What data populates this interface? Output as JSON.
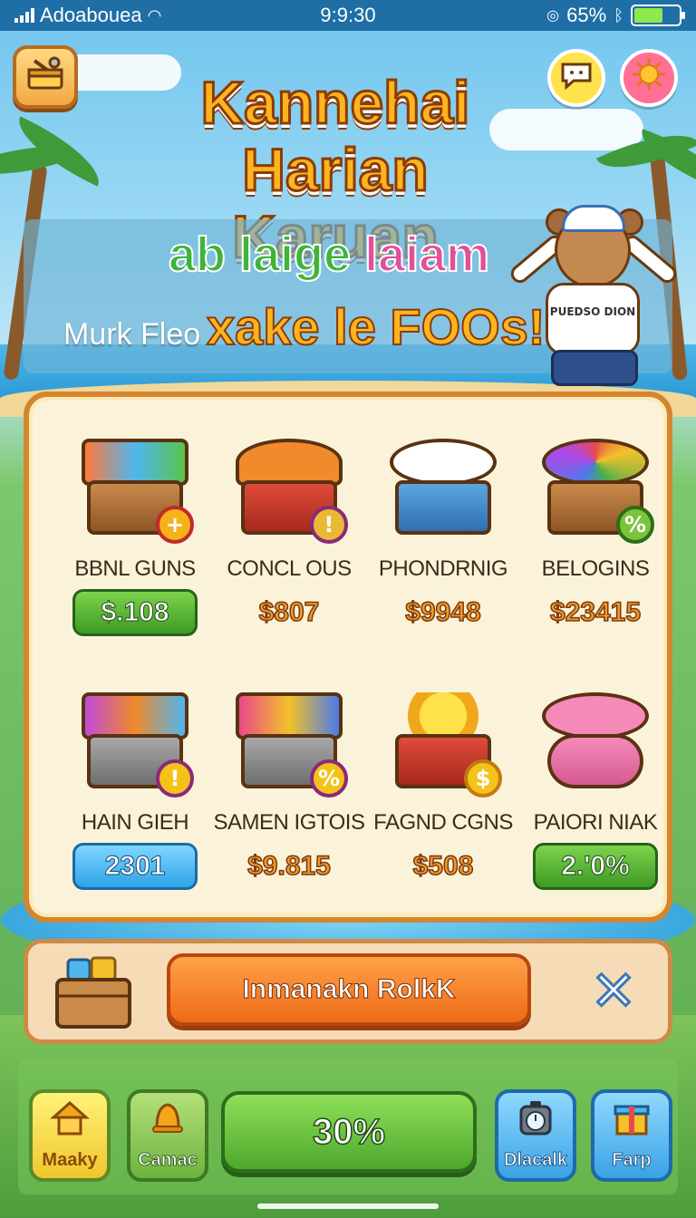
{
  "status_bar": {
    "carrier": "Adoabouea",
    "time": "9:9:30",
    "battery_percent": "65%",
    "battery_level": 0.65
  },
  "top_bar": {
    "menu_icon": "toolbox-icon",
    "left_round_icon": "chat-bubble-icon",
    "right_round_icon": "sun-icon"
  },
  "title": {
    "line1": "Kannehai",
    "line2": "Harian Karuan"
  },
  "banner": {
    "line1_a": "ab laige",
    "line1_b": "laiam",
    "small_text": "Murk Fleo",
    "big_text": "xake le FOOs!",
    "mascot_shirt": "PUEDSO DION"
  },
  "shop": {
    "items": [
      {
        "name": "BBNL GUNS",
        "price": "$.108",
        "price_style": "green-pill",
        "badge": "+"
      },
      {
        "name": "CONCL OUS",
        "price": "$807",
        "price_style": "text",
        "badge": "!"
      },
      {
        "name": "PHONDRNIG",
        "price": "$9948",
        "price_style": "text",
        "badge": ""
      },
      {
        "name": "BELOGINS",
        "price": "$23415",
        "price_style": "text",
        "badge": "%"
      },
      {
        "name": "HAIN GIEH",
        "price": "2301",
        "price_style": "blue-pill",
        "badge": "!"
      },
      {
        "name": "SAMEN IGTOIS",
        "price": "$9.815",
        "price_style": "text",
        "badge": "%"
      },
      {
        "name": "FAGND CGNS",
        "price": "$508",
        "price_style": "text",
        "badge": "$"
      },
      {
        "name": "PAIORI NIAK",
        "price": "2.'0%",
        "price_style": "green-pill",
        "badge": ""
      }
    ]
  },
  "action_bar": {
    "button_label": "Inmanakn RolkK",
    "close_icon": "close-icon"
  },
  "bottom_nav": {
    "items": [
      {
        "label": "Maaky",
        "icon": "house-icon"
      },
      {
        "label": "Camac",
        "icon": "bell-icon"
      },
      {
        "label": "30%",
        "icon": ""
      },
      {
        "label": "Dlacalk",
        "icon": "stopwatch-icon"
      },
      {
        "label": "Farp",
        "icon": "gift-box-icon"
      }
    ]
  }
}
